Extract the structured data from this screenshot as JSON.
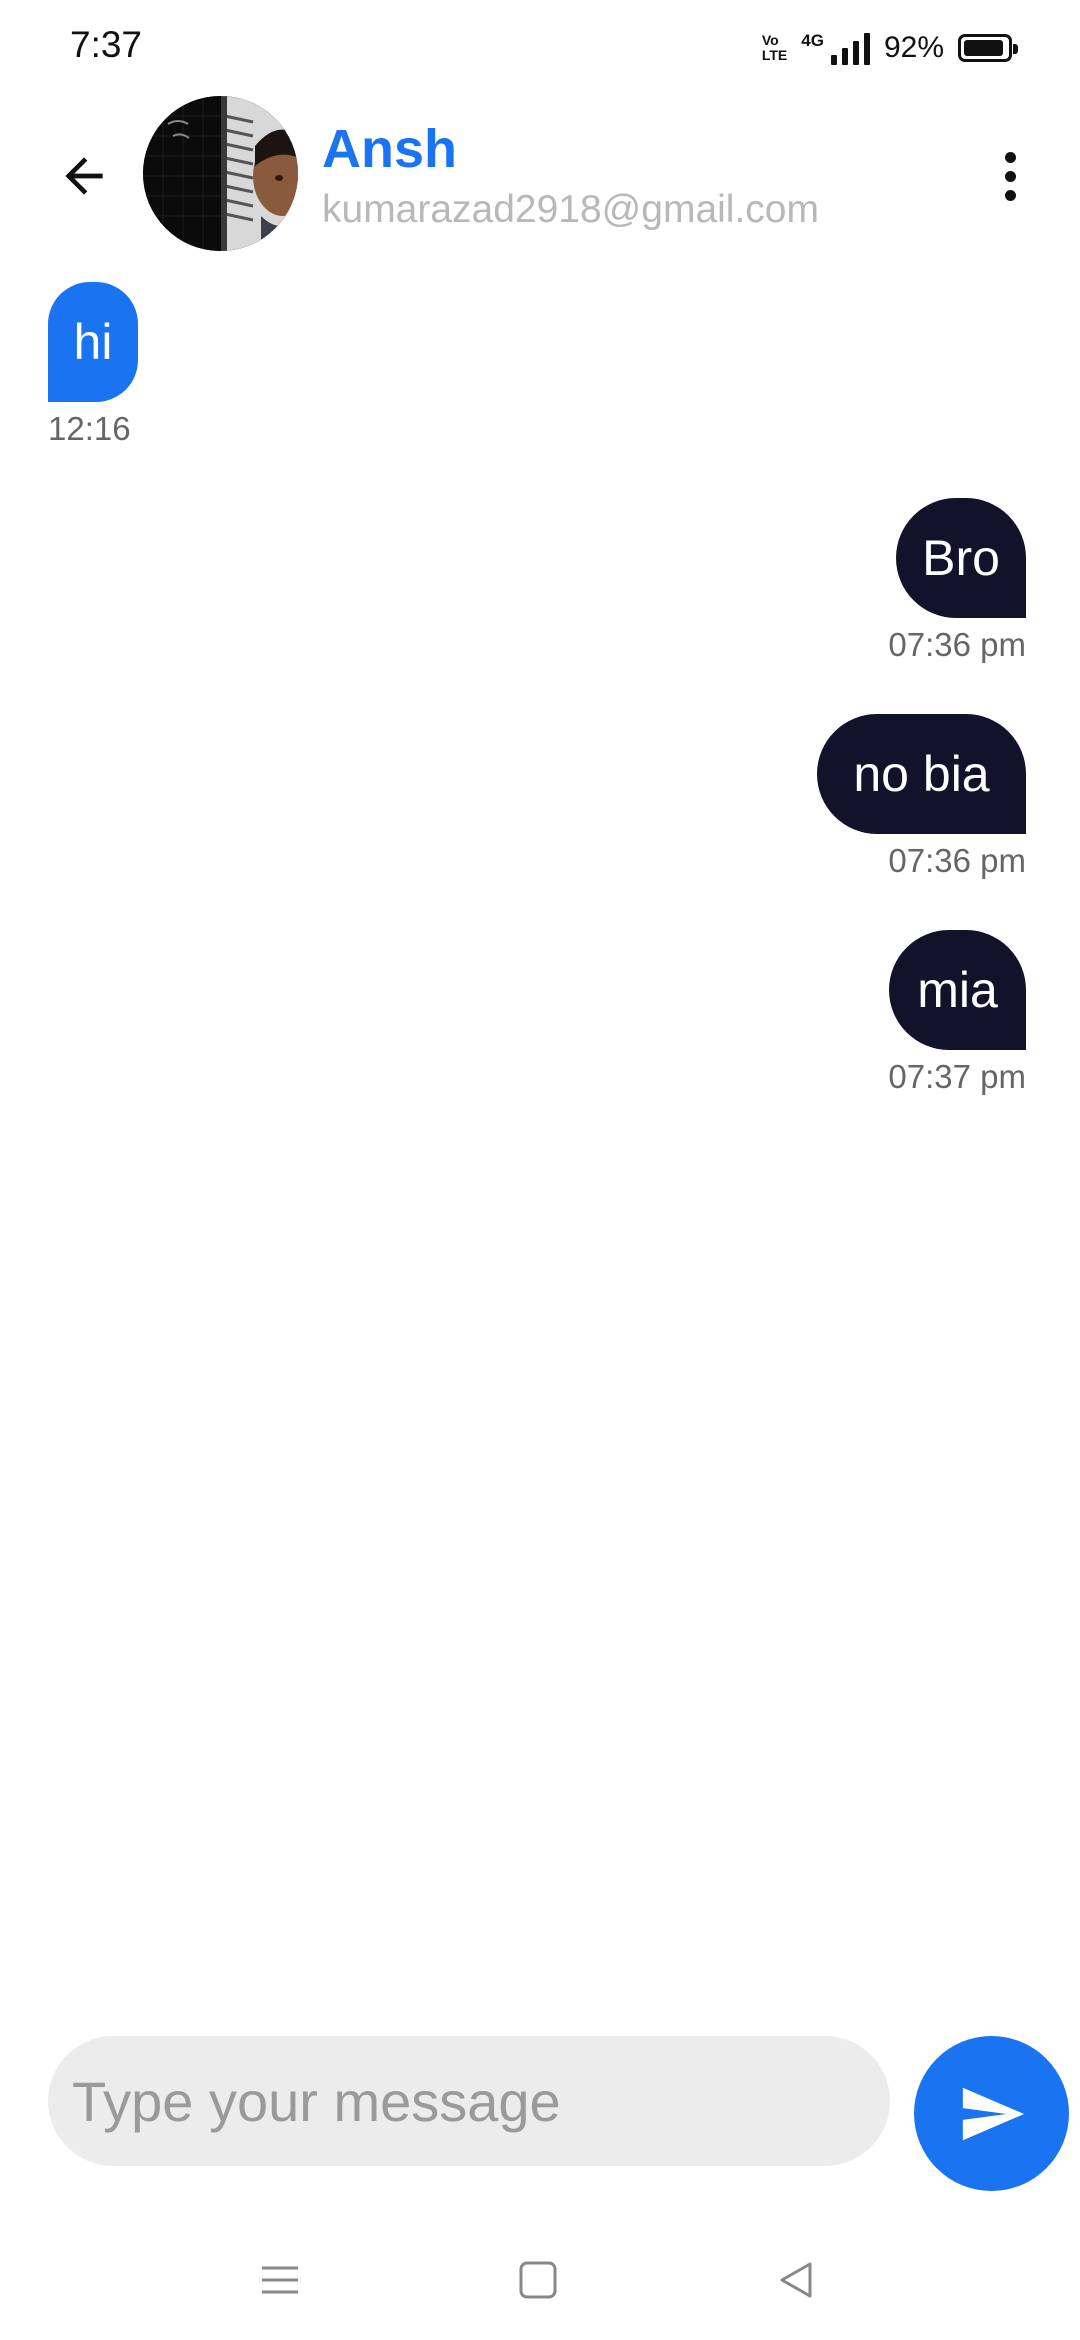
{
  "status_bar": {
    "time": "7:37",
    "volte_top": "Vo",
    "volte_bottom": "LTE",
    "network": "4G",
    "battery_percent": "92%",
    "battery_level": 0.92
  },
  "header": {
    "contact_name": "Ansh",
    "contact_email": "kumarazad2918@gmail.com",
    "back_icon": "arrow-left-icon",
    "menu_icon": "more-vertical-icon"
  },
  "messages": [
    {
      "direction": "incoming",
      "text": "hi",
      "time": "12:16"
    },
    {
      "direction": "outgoing",
      "text": "Bro",
      "time": "07:36 pm"
    },
    {
      "direction": "outgoing",
      "text": "no bia",
      "time": "07:36 pm"
    },
    {
      "direction": "outgoing",
      "text": "mia",
      "time": "07:37 pm"
    }
  ],
  "composer": {
    "placeholder": "Type your message",
    "value": "",
    "send_icon": "send-icon"
  },
  "navigation": {
    "items": [
      "menu-icon",
      "home-square-icon",
      "back-triangle-icon"
    ]
  },
  "colors": {
    "accent": "#1a73f0",
    "outgoing_bubble": "#12122a",
    "input_background": "#ececec",
    "email_text": "#b8b8b8"
  }
}
